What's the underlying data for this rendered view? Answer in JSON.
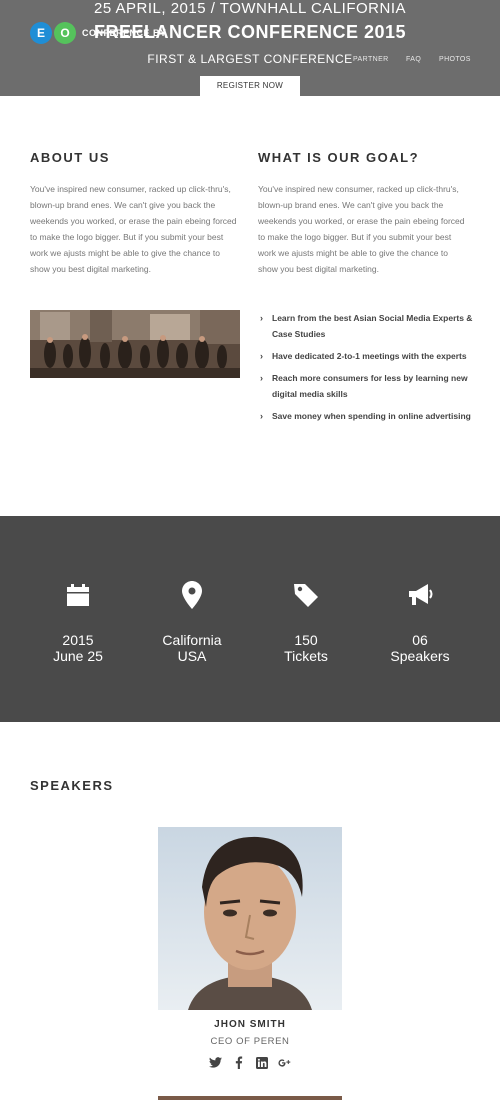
{
  "hero": {
    "date_location": "25 APRIL, 2015 / TOWNHALL CALIFORNIA",
    "logo_letters": [
      "E",
      "O"
    ],
    "logo_text": "CONFERENCE BY",
    "title": "FREELANCER CONFERENCE 2015",
    "subtitle": "FIRST & LARGEST CONFERENCE",
    "nav": [
      "PARTNER",
      "FAQ",
      "PHOTOS"
    ],
    "register_label": "REGISTER NOW",
    "bg_color": "#6d6d6d"
  },
  "about": {
    "title": "ABOUT US",
    "text": "You've inspired new consumer, racked up click-thru's, blown-up brand enes. We can't give you back the weekends you worked, or erase the pain ebeing forced to make the logo bigger. But if you submit your best work we ajusts might be able to give the chance to show you best digital marketing."
  },
  "goal": {
    "title": "WHAT IS OUR GOAL?",
    "text": "You've inspired new consumer, racked up click-thru's, blown-up brand enes. We can't give you back the weekends you worked, or erase the pain ebeing forced to make the logo bigger. But if you submit your best work we ajusts might be able to give the chance to show you best digital marketing.",
    "items": [
      "Learn from the best Asian Social Media Experts & Case Studies",
      "Have dedicated 2-to-1 meetings with the experts",
      "Reach more consumers for less by learning new digital media skills",
      "Save money when spending in online advertising"
    ]
  },
  "stats": [
    {
      "icon": "calendar-icon",
      "line1": "2015",
      "line2": "June 25"
    },
    {
      "icon": "location-pin-icon",
      "line1": "California",
      "line2": "USA"
    },
    {
      "icon": "ticket-tag-icon",
      "line1": "150",
      "line2": "Tickets"
    },
    {
      "icon": "megaphone-icon",
      "line1": "06",
      "line2": "Speakers"
    }
  ],
  "speakers": {
    "title": "SPEAKERS",
    "list": [
      {
        "name": "JHON SMITH",
        "role": "CEO OF PEREN",
        "socials": [
          "twitter-icon",
          "facebook-icon",
          "linkedin-icon",
          "google-plus-icon"
        ]
      }
    ]
  },
  "colors": {
    "accent_dark": "#4a4a4a",
    "hero": "#6d6d6d",
    "text": "#333333",
    "muted": "#777777"
  }
}
